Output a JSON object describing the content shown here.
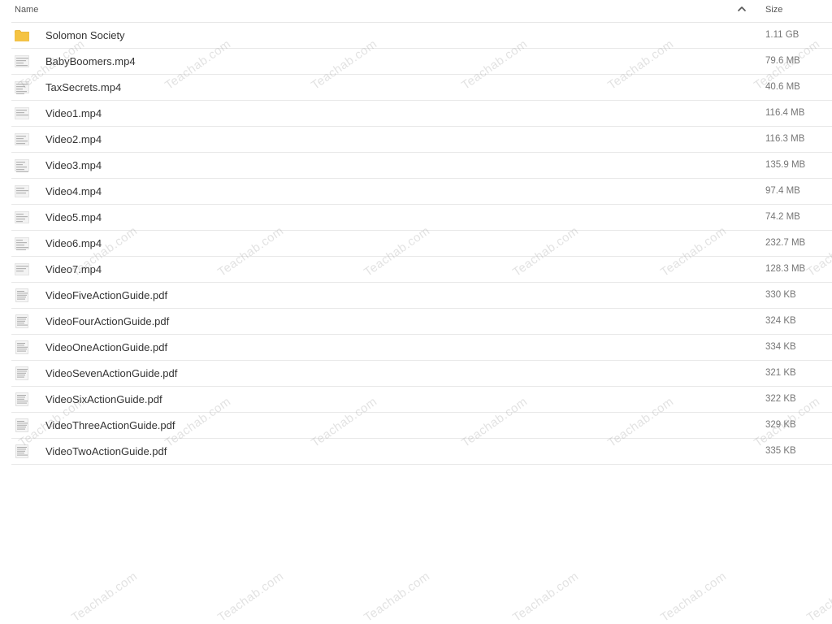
{
  "header": {
    "name_label": "Name",
    "size_label": "Size",
    "sort_direction": "ascending"
  },
  "files": [
    {
      "name": "Solomon Society",
      "size": "1.11 GB",
      "kind": "folder",
      "icon": "folder-icon"
    },
    {
      "name": "BabyBoomers.mp4",
      "size": "79.6 MB",
      "kind": "video",
      "icon": "video-thumbnail-icon"
    },
    {
      "name": "TaxSecrets.mp4",
      "size": "40.6 MB",
      "kind": "video",
      "icon": "video-thumbnail-icon"
    },
    {
      "name": "Video1.mp4",
      "size": "116.4 MB",
      "kind": "video",
      "icon": "video-thumbnail-icon"
    },
    {
      "name": "Video2.mp4",
      "size": "116.3 MB",
      "kind": "video",
      "icon": "video-thumbnail-icon"
    },
    {
      "name": "Video3.mp4",
      "size": "135.9 MB",
      "kind": "video",
      "icon": "video-thumbnail-icon"
    },
    {
      "name": "Video4.mp4",
      "size": "97.4 MB",
      "kind": "video",
      "icon": "video-thumbnail-icon"
    },
    {
      "name": "Video5.mp4",
      "size": "74.2 MB",
      "kind": "video",
      "icon": "video-thumbnail-icon"
    },
    {
      "name": "Video6.mp4",
      "size": "232.7 MB",
      "kind": "video",
      "icon": "video-thumbnail-icon"
    },
    {
      "name": "Video7.mp4",
      "size": "128.3 MB",
      "kind": "video",
      "icon": "video-thumbnail-icon"
    },
    {
      "name": "VideoFiveActionGuide.pdf",
      "size": "330 KB",
      "kind": "pdf",
      "icon": "pdf-thumbnail-icon"
    },
    {
      "name": "VideoFourActionGuide.pdf",
      "size": "324 KB",
      "kind": "pdf",
      "icon": "pdf-thumbnail-icon"
    },
    {
      "name": "VideoOneActionGuide.pdf",
      "size": "334 KB",
      "kind": "pdf",
      "icon": "pdf-thumbnail-icon"
    },
    {
      "name": "VideoSevenActionGuide.pdf",
      "size": "321 KB",
      "kind": "pdf",
      "icon": "pdf-thumbnail-icon"
    },
    {
      "name": "VideoSixActionGuide.pdf",
      "size": "322 KB",
      "kind": "pdf",
      "icon": "pdf-thumbnail-icon"
    },
    {
      "name": "VideoThreeActionGuide.pdf",
      "size": "329 KB",
      "kind": "pdf",
      "icon": "pdf-thumbnail-icon"
    },
    {
      "name": "VideoTwoActionGuide.pdf",
      "size": "335 KB",
      "kind": "pdf",
      "icon": "pdf-thumbnail-icon"
    }
  ],
  "watermark": {
    "text": "Teachab.com"
  },
  "colors": {
    "folder": "#f5c342",
    "folder_dark": "#e6ad1f",
    "row_border": "#e8e8e8",
    "size_text": "#767676"
  }
}
